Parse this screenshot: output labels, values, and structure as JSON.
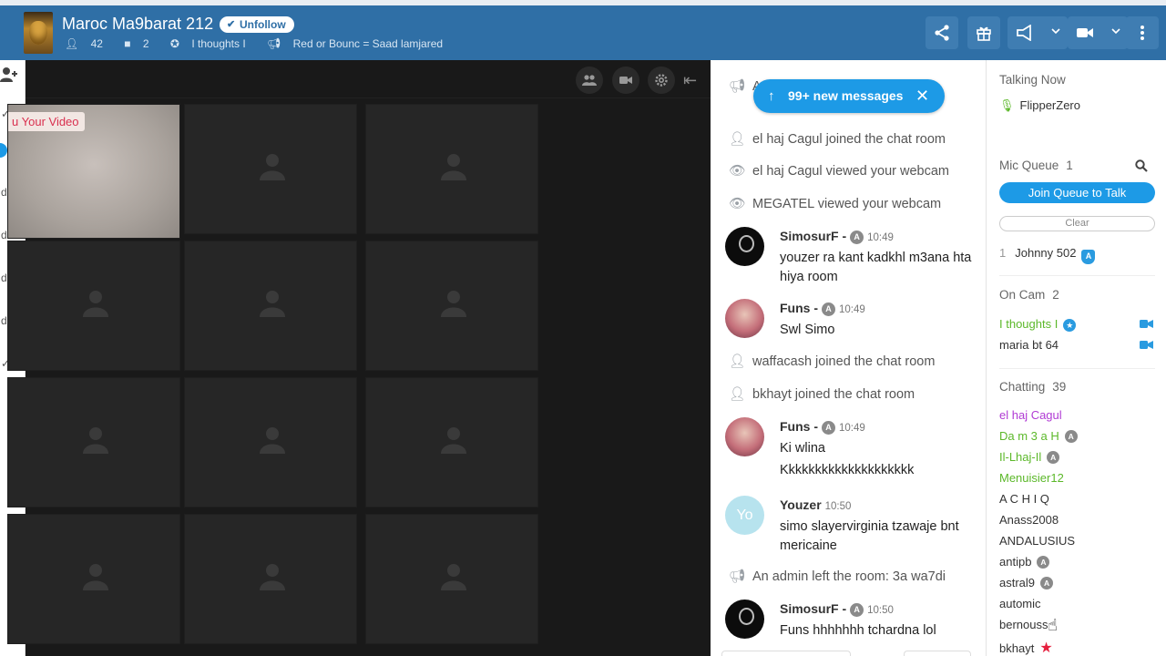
{
  "header": {
    "room_title": "Maroc Ma9barat 212",
    "follow_label": "Unfollow",
    "users_count": "42",
    "cams_count": "2",
    "owner": "I thoughts I",
    "announcement": "Red or Bounc = Saad lamjared",
    "brand_color": "#2f6fa6",
    "icons": [
      "share-icon",
      "gift-icon",
      "megaphone-icon",
      "camera-icon",
      "more-icon"
    ]
  },
  "left_rail": {
    "items": [
      "✓",
      "d",
      "d",
      "d",
      "d",
      "✓"
    ]
  },
  "video": {
    "self_label": "Your Video",
    "self_prefix": "u"
  },
  "chat": {
    "new_messages": "99+ new messages",
    "messages": [
      {
        "type": "system",
        "icon": "megaphone-icon",
        "text": "A"
      },
      {
        "type": "system",
        "icon": "person-icon",
        "text": "el haj Cagul joined the chat room"
      },
      {
        "type": "system",
        "icon": "eye-icon",
        "text": "el haj Cagul viewed your webcam"
      },
      {
        "type": "system",
        "icon": "eye-icon",
        "text": "MEGATEL viewed your webcam"
      },
      {
        "type": "message",
        "name": "SimosurF -",
        "badge": "A",
        "time": "10:49",
        "text": "youzer ra kant kadkhl m3ana hta hiya room"
      },
      {
        "type": "message",
        "name": "Funs -",
        "badge": "A",
        "time": "10:49",
        "text": "Swl Simo"
      },
      {
        "type": "system",
        "icon": "person-icon",
        "text": "waffacash joined the chat room"
      },
      {
        "type": "system",
        "icon": "person-icon",
        "text": "bkhayt joined the chat room"
      },
      {
        "type": "message",
        "name": "Funs -",
        "badge": "A",
        "time": "10:49",
        "text": "Ki wlina",
        "text2": "Kkkkkkkkkkkkkkkkkkkk"
      },
      {
        "type": "message",
        "name": "Youzer",
        "time": "10:50",
        "avatar_text": "Yo",
        "text": "simo slayervirginia tzawaje bnt mericaine"
      },
      {
        "type": "system",
        "icon": "megaphone-icon",
        "text": "An admin left the room: 3a wa7di"
      },
      {
        "type": "message",
        "name": "SimosurF -",
        "badge": "A",
        "time": "10:50",
        "text": "Funs hhhhhhh tchardna lol"
      }
    ]
  },
  "users": {
    "talking_now_label": "Talking Now",
    "talking_now": "FlipperZero",
    "mic_queue_label": "Mic Queue",
    "mic_queue_count": "1",
    "join_queue_label": "Join Queue to Talk",
    "clear_label": "Clear",
    "queue": [
      {
        "pos": "1",
        "name": "Johnny 502",
        "badge": "A"
      }
    ],
    "on_cam_label": "On Cam",
    "on_cam_count": "2",
    "on_cam": [
      "I thoughts I",
      "maria bt 64"
    ],
    "chatting_label": "Chatting",
    "chatting_count": "39",
    "chatting": [
      {
        "name": "el haj Cagul",
        "color": "#b03ad4"
      },
      {
        "name": "Da m 3 a H",
        "color": "#5cb82a",
        "badge": "A"
      },
      {
        "name": "Il-Lhaj-Il",
        "color": "#5cb82a",
        "badge": "A"
      },
      {
        "name": "Menuisier12",
        "color": "#5cb82a"
      },
      {
        "name": "A C H I Q"
      },
      {
        "name": "Anass2008"
      },
      {
        "name": "ANDALUSIUS"
      },
      {
        "name": "antipb",
        "badge": "A"
      },
      {
        "name": "astral9",
        "badge": "A"
      },
      {
        "name": "automic"
      },
      {
        "name": "bernouss"
      },
      {
        "name": "bkhayt",
        "star": "★"
      }
    ]
  }
}
